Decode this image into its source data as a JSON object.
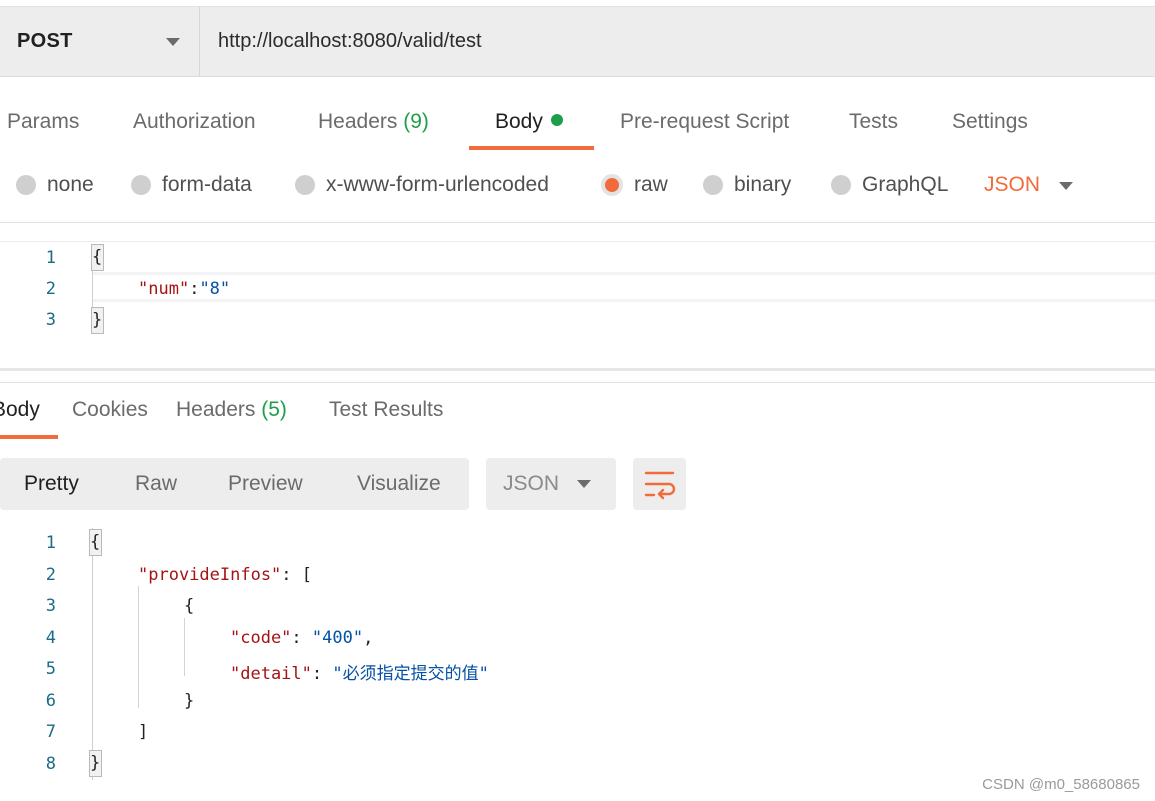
{
  "request": {
    "method": "POST",
    "url": "http://localhost:8080/valid/test"
  },
  "request_tabs": [
    {
      "label": "Params",
      "count": ""
    },
    {
      "label": "Authorization",
      "count": ""
    },
    {
      "label": "Headers",
      "count": "(9)"
    },
    {
      "label": "Body",
      "count": ""
    },
    {
      "label": "Pre-request Script",
      "count": ""
    },
    {
      "label": "Tests",
      "count": ""
    },
    {
      "label": "Settings",
      "count": ""
    }
  ],
  "body_types": [
    "none",
    "form-data",
    "x-www-form-urlencoded",
    "raw",
    "binary",
    "GraphQL"
  ],
  "body_selected": "raw",
  "body_format": "JSON",
  "request_body": {
    "line_numbers": [
      "1",
      "2",
      "3"
    ],
    "open_brace": "{",
    "key": "\"num\"",
    "colon": ":",
    "value": "\"8\"",
    "close_brace": "}"
  },
  "response_tabs": [
    {
      "label": "Body",
      "count": ""
    },
    {
      "label": "Cookies",
      "count": ""
    },
    {
      "label": "Headers",
      "count": "(5)"
    },
    {
      "label": "Test Results",
      "count": ""
    }
  ],
  "view_modes": [
    "Pretty",
    "Raw",
    "Preview",
    "Visualize"
  ],
  "view_selected": "Pretty",
  "response_format": "JSON",
  "response_body": {
    "line_numbers": [
      "1",
      "2",
      "3",
      "4",
      "5",
      "6",
      "7",
      "8"
    ],
    "open_brace": "{",
    "array_key": "\"provideInfos\"",
    "array_open": ": [",
    "obj_open": "{",
    "code_key": "\"code\"",
    "code_value": "\"400\"",
    "detail_key": "\"detail\"",
    "detail_value": "\"必须指定提交的值\"",
    "obj_close": "}",
    "array_close": "]",
    "close_brace": "}"
  },
  "watermark": "CSDN @m0_58680865",
  "colors": {
    "accent": "#f26b3a",
    "count_green": "#1e9e4a",
    "json_key": "#a31515",
    "json_string": "#0451a5"
  }
}
